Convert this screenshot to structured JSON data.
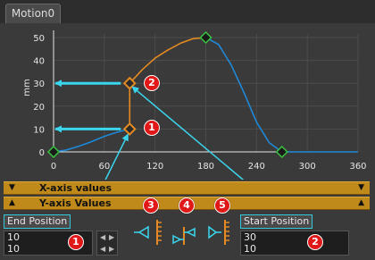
{
  "window": {
    "tab_label": "Motion0"
  },
  "colors": {
    "background": "#3a3a3a",
    "curve": "#1f88d8",
    "curve_selected": "#e58a22",
    "arrow": "#3ad6ee",
    "section_bar": "#c08a1a",
    "badge": "#e01818",
    "grid": "#4c4c4c"
  },
  "chart_data": {
    "type": "line",
    "ylabel": "mm",
    "xlim": [
      0,
      360
    ],
    "ylim": [
      0,
      50
    ],
    "x_ticks": [
      "0",
      "60",
      "120",
      "180",
      "240",
      "300",
      "360"
    ],
    "y_ticks": [
      "0",
      "10",
      "20",
      "30",
      "40",
      "50"
    ],
    "keypoints": [
      {
        "x": 0,
        "y": 0,
        "role": "start"
      },
      {
        "x": 90,
        "y": 10,
        "role": "selected"
      },
      {
        "x": 90,
        "y": 30,
        "role": "selected"
      },
      {
        "x": 180,
        "y": 50,
        "role": "peak"
      },
      {
        "x": 270,
        "y": 0,
        "role": "end"
      }
    ],
    "series": [
      {
        "segment": "rise",
        "color": "#1f88d8",
        "x": [
          0,
          15,
          30,
          45,
          60,
          75,
          90
        ],
        "y": [
          0,
          0.8,
          2.5,
          4.5,
          6.8,
          8.6,
          10
        ]
      },
      {
        "segment": "jump",
        "color": "#e58a22",
        "x": [
          90,
          90
        ],
        "y": [
          10,
          30
        ]
      },
      {
        "segment": "accel",
        "color": "#e58a22",
        "x": [
          90,
          105,
          120,
          135,
          150,
          165,
          180
        ],
        "y": [
          30,
          36,
          41,
          44.5,
          47.5,
          49.5,
          50
        ]
      },
      {
        "segment": "fall",
        "color": "#1f88d8",
        "x": [
          180,
          195,
          210,
          225,
          240,
          255,
          270,
          300,
          330,
          360
        ],
        "y": [
          50,
          47,
          38,
          26,
          13,
          4,
          0,
          0,
          0,
          0
        ]
      }
    ],
    "arrows_to_y_axis": [
      10,
      30
    ]
  },
  "sections": {
    "x_axis": {
      "label": "X-axis values"
    },
    "y_axis": {
      "label": "Y-axis Values"
    }
  },
  "end_position": {
    "label": "End Position",
    "values": [
      "10",
      "10"
    ]
  },
  "start_position": {
    "label": "Start Position",
    "values": [
      "30",
      "10"
    ]
  },
  "badges": [
    "1",
    "2",
    "3",
    "4",
    "5",
    "1",
    "2"
  ]
}
